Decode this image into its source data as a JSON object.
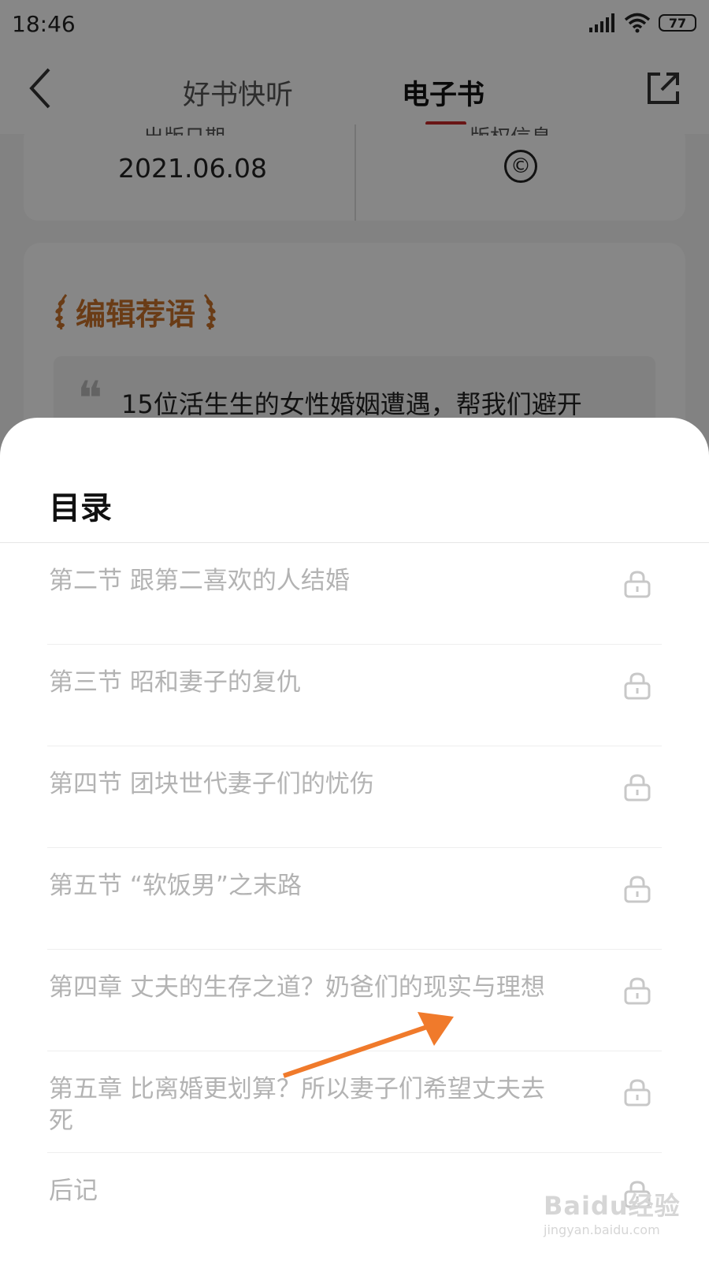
{
  "status_bar": {
    "time": "18:46",
    "battery": "77"
  },
  "nav": {
    "tabs": [
      {
        "label": "好书快听",
        "active": false
      },
      {
        "label": "电子书",
        "active": true
      }
    ],
    "accent_color": "#c62828"
  },
  "info_card": {
    "left_label": "出版日期",
    "left_value": "2021.06.08",
    "right_label": "版权信息",
    "right_symbol": "©"
  },
  "recommendation": {
    "title": "编辑荐语",
    "quote": "15位活生生的女性婚姻遭遇，帮我们避开"
  },
  "toc": {
    "title": "目录",
    "items": [
      {
        "label": "第二节 跟第二喜欢的人结婚"
      },
      {
        "label": "第三节 昭和妻子的复仇"
      },
      {
        "label": "第四节 团块世代妻子们的忧伤"
      },
      {
        "label": "第五节 “软饭男”之末路"
      },
      {
        "label": "第四章 丈夫的生存之道？奶爸们的现实与理想"
      },
      {
        "label": "第五章 比离婚更划算？所以妻子们希望丈夫去死"
      },
      {
        "label": "后记"
      }
    ]
  },
  "annotation_arrow_color": "#f07a2b",
  "watermark": {
    "main": "Baidu经验",
    "sub": "jingyan.baidu.com"
  }
}
